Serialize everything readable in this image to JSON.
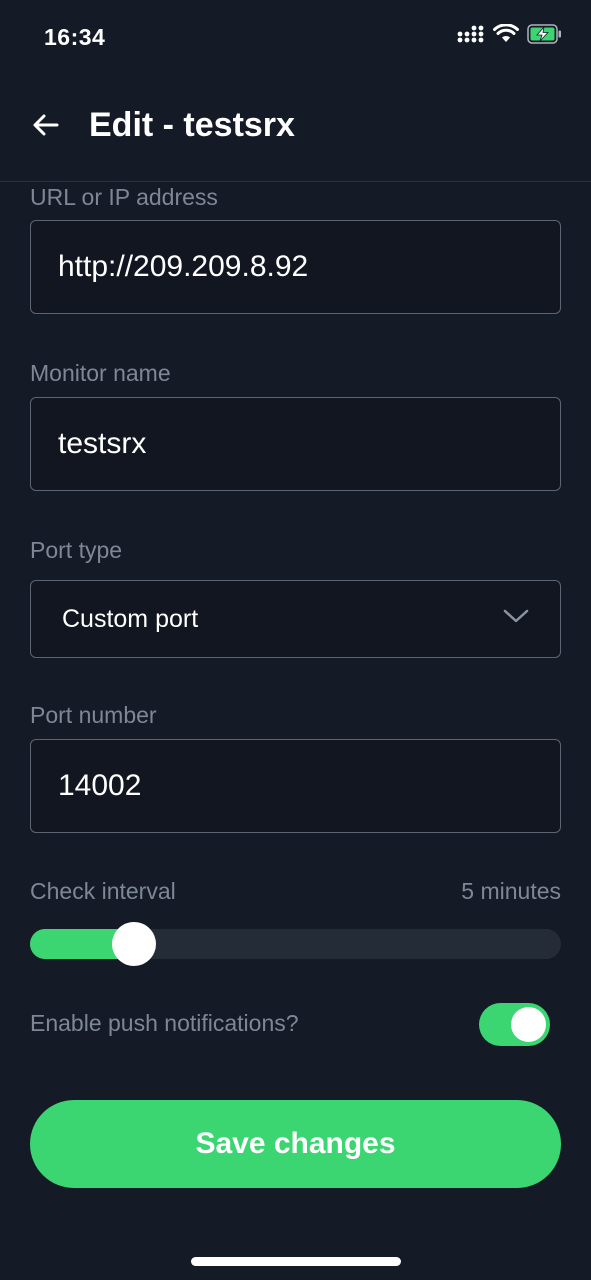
{
  "status_bar": {
    "time": "16:34",
    "icons": [
      "signal-icon",
      "wifi-icon",
      "battery-charging-icon"
    ]
  },
  "header": {
    "title": "Edit - testsrx",
    "back_icon": "arrow-left-icon"
  },
  "form": {
    "url": {
      "label": "URL or IP address",
      "value": "http://209.209.8.92"
    },
    "monitor_name": {
      "label": "Monitor name",
      "value": "testsrx"
    },
    "port_type": {
      "label": "Port type",
      "value": "Custom port",
      "icon": "chevron-down-icon"
    },
    "port_number": {
      "label": "Port number",
      "value": "14002"
    },
    "check_interval": {
      "label": "Check interval",
      "value": "5 minutes",
      "fill_fraction": 0.195
    },
    "push_notifications": {
      "label": "Enable push notifications?",
      "enabled": true
    }
  },
  "save_button": {
    "label": "Save changes"
  },
  "colors": {
    "background": "#151b26",
    "accent": "#3bd671",
    "label": "#7d8796",
    "border": "#5d6573"
  }
}
